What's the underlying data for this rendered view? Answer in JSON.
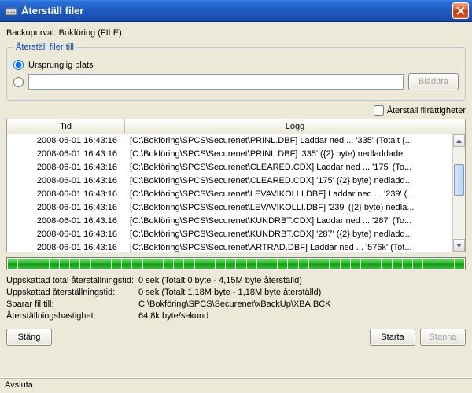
{
  "window": {
    "title": "Återställ filer",
    "close_icon": "close"
  },
  "backup_line": {
    "label": "Backupurval:",
    "value": "Bokföring (FILE)"
  },
  "groupbox": {
    "legend": "Återställ filer till",
    "radio_original": {
      "label": "Ursprunglig plats",
      "checked": true
    },
    "radio_custom": {
      "checked": false
    },
    "path_value": "",
    "browse_label": "Bläddra",
    "browse_disabled": true
  },
  "restore_rights": {
    "label": "Återställ filrättigheter",
    "checked": false
  },
  "table": {
    "headers": {
      "time": "Tid",
      "log": "Logg"
    },
    "rows": [
      {
        "time": "2008-06-01 16:43:16",
        "log": "[C:\\Bokföring\\SPCS\\Securenet\\PRINL.DBF] Laddar ned ... '335' (Totalt {..."
      },
      {
        "time": "2008-06-01 16:43:16",
        "log": "[C:\\Bokföring\\SPCS\\Securenet\\PRINL.DBF] '335' ({2} byte) nedladdade"
      },
      {
        "time": "2008-06-01 16:43:16",
        "log": "[C:\\Bokföring\\SPCS\\Securenet\\CLEARED.CDX] Laddar ned ... '175' (To..."
      },
      {
        "time": "2008-06-01 16:43:16",
        "log": "[C:\\Bokföring\\SPCS\\Securenet\\CLEARED.CDX] '175' ({2} byte) nedladd..."
      },
      {
        "time": "2008-06-01 16:43:16",
        "log": "[C:\\Bokföring\\SPCS\\Securenet\\LEVAVIKOLLI.DBF] Laddar ned ... '239' (..."
      },
      {
        "time": "2008-06-01 16:43:16",
        "log": "[C:\\Bokföring\\SPCS\\Securenet\\LEVAVIKOLLI.DBF] '239' ({2} byte) nedla..."
      },
      {
        "time": "2008-06-01 16:43:16",
        "log": "[C:\\Bokföring\\SPCS\\Securenet\\KUNDRBT.CDX] Laddar ned ... '287' (To..."
      },
      {
        "time": "2008-06-01 16:43:16",
        "log": "[C:\\Bokföring\\SPCS\\Securenet\\KUNDRBT.CDX] '287' ({2} byte) nedladd..."
      },
      {
        "time": "2008-06-01 16:43:16",
        "log": "[C:\\Bokföring\\SPCS\\Securenet\\ARTRAD.DBF] Laddar ned ... '576k' (Tot..."
      }
    ]
  },
  "progress": {
    "segments": 44
  },
  "stats": {
    "rows": [
      {
        "k": "Uppskattad total återställningstid:",
        "v": "0 sek (Totalt 0 byte - 4,15M byte återställd)"
      },
      {
        "k": "Uppskattad återställningstid:",
        "v": "0 sek (Totalt 1,18M byte - 1,18M byte återställd)"
      },
      {
        "k": "Sparar fil till:",
        "v": "C:\\Bokföring\\SPCS\\Securenet\\xBackUp\\XBA.BCK"
      },
      {
        "k": "Återställningshastighet:",
        "v": "64,8k byte/sekund"
      }
    ]
  },
  "buttons": {
    "close": "Stäng",
    "start": "Starta",
    "stop": "Stanna",
    "stop_disabled": true
  },
  "statusbar": {
    "text": "Avsluta"
  }
}
